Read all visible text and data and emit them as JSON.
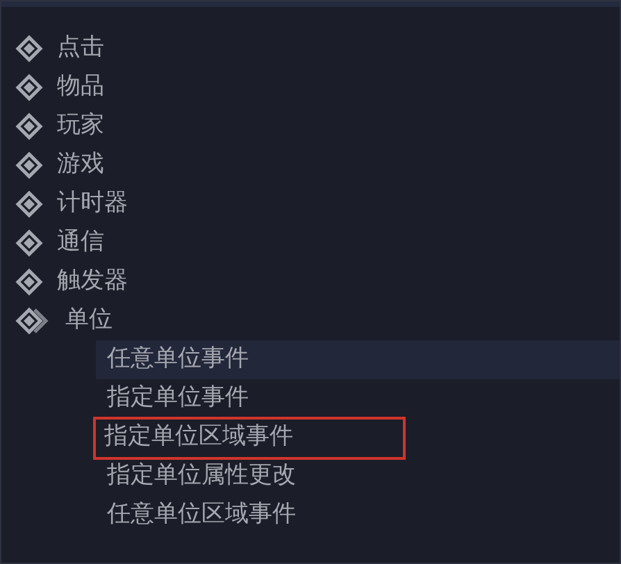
{
  "tree": [
    {
      "label": "点击",
      "expanded": false
    },
    {
      "label": "物品",
      "expanded": false
    },
    {
      "label": "玩家",
      "expanded": false
    },
    {
      "label": "游戏",
      "expanded": false
    },
    {
      "label": "计时器",
      "expanded": false
    },
    {
      "label": "通信",
      "expanded": false
    },
    {
      "label": "触发器",
      "expanded": false
    },
    {
      "label": "单位",
      "expanded": true,
      "children": [
        {
          "label": "任意单位事件",
          "selected": true,
          "outlined": false
        },
        {
          "label": "指定单位事件",
          "selected": false,
          "outlined": false
        },
        {
          "label": "指定单位区域事件",
          "selected": false,
          "outlined": true
        },
        {
          "label": "指定单位属性更改",
          "selected": false,
          "outlined": false
        },
        {
          "label": "任意单位区域事件",
          "selected": false,
          "outlined": false
        }
      ]
    }
  ]
}
